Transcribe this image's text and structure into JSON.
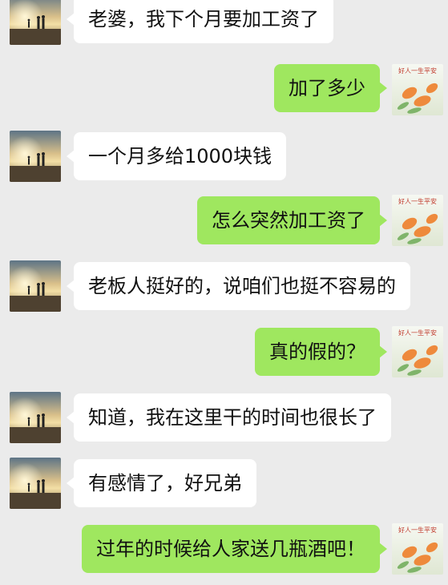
{
  "contacts": {
    "left_avatar_icon": "beach-couple-avatar-icon",
    "right_avatar_icon": "flower-avatar-icon",
    "right_avatar_caption": "好人一生平安"
  },
  "messages": [
    {
      "side": "left",
      "text": "老婆，我下个月要加工资了"
    },
    {
      "side": "right",
      "text": "加了多少"
    },
    {
      "side": "left",
      "text": "一个月多给1000块钱"
    },
    {
      "side": "right",
      "text": "怎么突然加工资了"
    },
    {
      "side": "left",
      "text": "老板人挺好的，说咱们也挺不容易的"
    },
    {
      "side": "right",
      "text": "真的假的？"
    },
    {
      "side": "left",
      "text": "知道，我在这里干的时间也很长了"
    },
    {
      "side": "left",
      "text": "有感情了，好兄弟"
    },
    {
      "side": "right",
      "text": "过年的时候给人家送几瓶酒吧！"
    }
  ],
  "colors": {
    "background": "#ebebeb",
    "incoming_bubble": "#ffffff",
    "outgoing_bubble": "#9fe75f"
  }
}
